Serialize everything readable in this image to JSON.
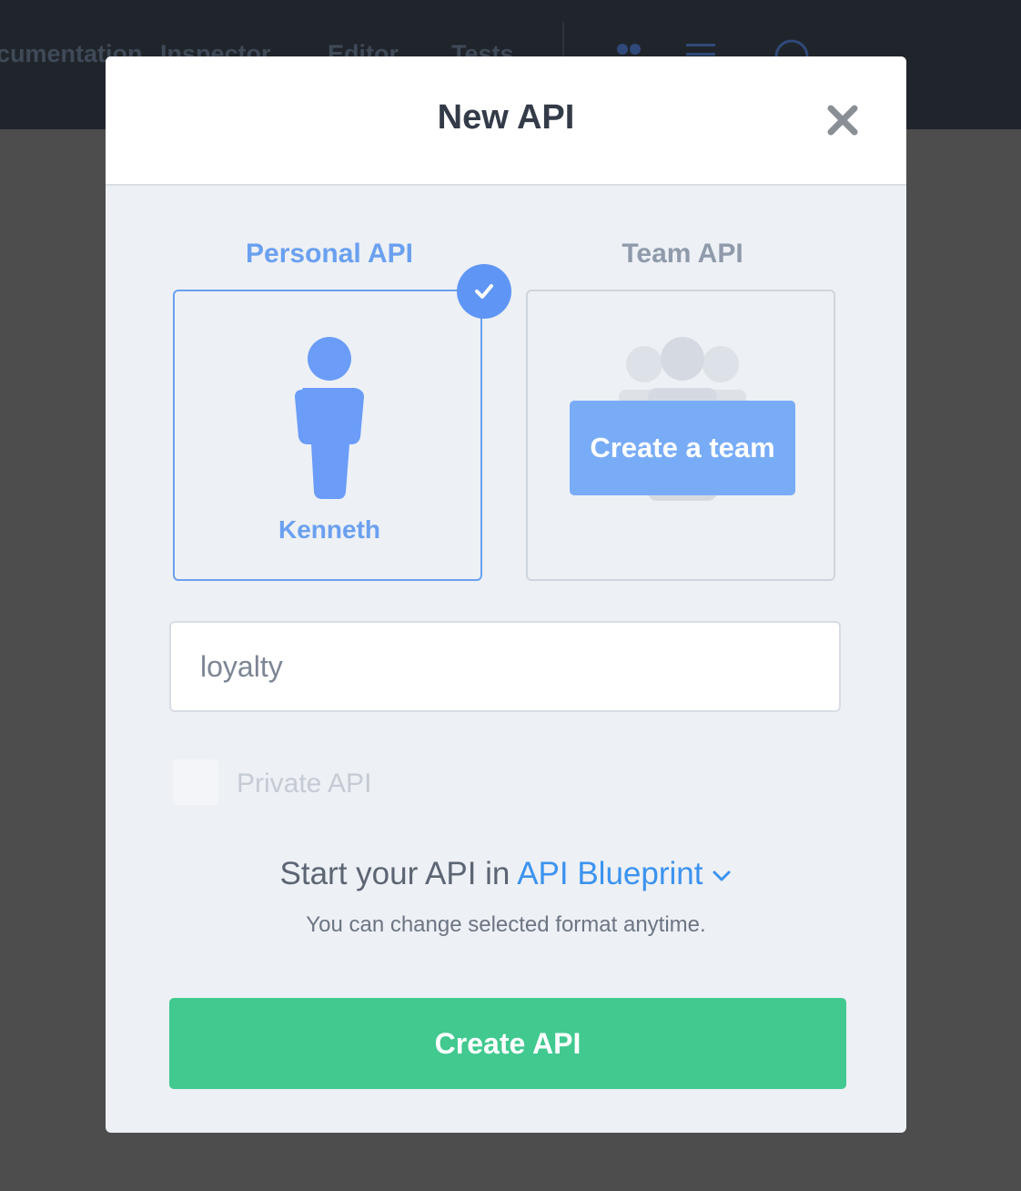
{
  "background_nav": {
    "items": [
      "Documentation",
      "Inspector",
      "Editor",
      "Tests"
    ]
  },
  "modal": {
    "title": "New API",
    "close_icon": "close-icon",
    "options": {
      "personal": {
        "label": "Personal API",
        "user_name": "Kenneth",
        "selected": true,
        "icon": "person-icon"
      },
      "team": {
        "label": "Team API",
        "create_team_label": "Create a team",
        "icon": "team-icon"
      }
    },
    "name_input": {
      "value": "loyalty",
      "placeholder": ""
    },
    "private_checkbox": {
      "label": "Private API",
      "checked": false
    },
    "format": {
      "prefix": "Start your API in",
      "selected": "API Blueprint",
      "note": "You can change selected format anytime."
    },
    "submit_label": "Create API"
  },
  "colors": {
    "accent_blue": "#5f96f5",
    "link_blue": "#3b93ef",
    "submit_green": "#41c98f",
    "overlay": "#4d4d4d"
  }
}
